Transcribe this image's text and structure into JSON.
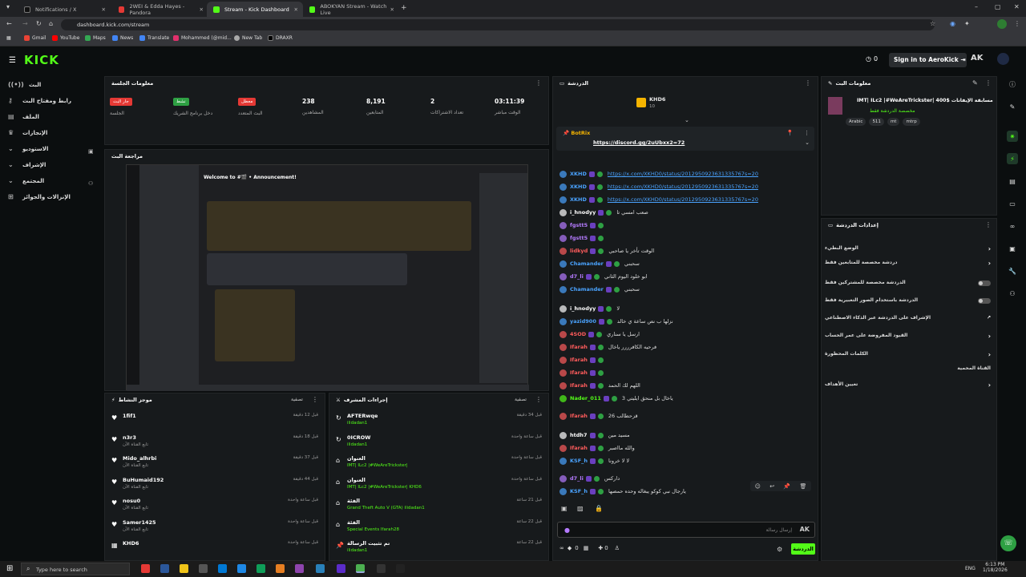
{
  "browser": {
    "tabs": [
      {
        "label": "Notifications / X",
        "color": "#111111"
      },
      {
        "label": "2WEI & Edda Hayes - Pandora",
        "color": "#e53935"
      },
      {
        "label": "Stream - Kick Dashboard",
        "color": "#53fc18"
      },
      {
        "label": "ABOKYAN Stream - Watch Live",
        "color": "#53fc18"
      }
    ],
    "url": "dashboard.kick.com/stream",
    "bookmarks": [
      "Gmail",
      "YouTube",
      "Maps",
      "News",
      "Translate",
      "Mohammed (@mid...",
      "New Tab",
      "DRAXR"
    ]
  },
  "header": {
    "logo": "KICK",
    "notif_count": "0",
    "signin_label": "Sign in to AeroKick"
  },
  "sidebar": {
    "items": [
      "البث",
      "رابط ومفتاح البث",
      "الملف",
      "الإنجازات",
      "الاستوديو",
      "الإشراف",
      "المجتمع",
      "الإنزالات والجوائز"
    ]
  },
  "session": {
    "title": "معلومات الجلسة",
    "badges": [
      {
        "label": "جار البث",
        "color": "#e53935",
        "sub": "الجلسة"
      },
      {
        "label": "نشط",
        "color": "#2ea043",
        "sub": "دخل برنامج الشريك"
      },
      {
        "label": "معطل",
        "color": "#e53935",
        "sub": "البث المتعدد"
      }
    ],
    "stats": [
      {
        "value": "238",
        "label": "المشاهدين"
      },
      {
        "value": "8,191",
        "label": "المتابعين"
      },
      {
        "value": "2",
        "label": "تعداد الاشتراكات"
      },
      {
        "value": "03:11:39",
        "label": "الوقت مباشر"
      }
    ]
  },
  "preview": {
    "title": "مراجعة البث",
    "welcome": "Welcome to #🎬 • Announcement!",
    "channel": "• Announcement!"
  },
  "activity": {
    "title": "موجز النشاط",
    "filter": "تصفية",
    "rows": [
      {
        "name": "1fif1",
        "sub": "",
        "time": "قبل 12 دقيقة"
      },
      {
        "name": "n3r3",
        "sub": "تابع القناة الآن",
        "time": "قبل 18 دقيقة"
      },
      {
        "name": "Mido_alhrbi",
        "sub": "تابع القناة الآن",
        "time": "قبل 37 دقيقة"
      },
      {
        "name": "BuHumaid192",
        "sub": "تابع القناة الآن",
        "time": "قبل 44 دقيقة"
      },
      {
        "name": "nosu0",
        "sub": "تابع القناة الآن",
        "time": "قبل ساعة واحدة"
      },
      {
        "name": "Samer1425",
        "sub": "تابع القناة الآن",
        "time": "قبل ساعة واحدة"
      },
      {
        "name": "KHD6",
        "sub": "",
        "time": "قبل ساعة واحدة"
      }
    ]
  },
  "modactions": {
    "title": "إجراءات المشرف",
    "filter": "تصفية",
    "rows": [
      {
        "name": "AFTERwqe",
        "sub": "ilidadan1",
        "time": "قبل 34 دقيقة"
      },
      {
        "name": "0ICROW",
        "sub": "ilidadan1",
        "time": "قبل ساعة واحدة"
      },
      {
        "name": "العنوان",
        "sub": "IMT| ILc2 |#WeAreTrickster|",
        "time": "قبل ساعة واحدة"
      },
      {
        "name": "العنوان",
        "sub": "IMT| ILc2 |#WeAreTrickster| KHD6",
        "time": "قبل ساعة واحدة"
      },
      {
        "name": "الفئة",
        "sub": "Grand Theft Auto V (GTA) ilidadan1",
        "time": "قبل 21 ساعة"
      },
      {
        "name": "الفئة",
        "sub": "Special Events Ifarah28",
        "time": "قبل 22 ساعة"
      },
      {
        "name": "تم تثبيت الرسالة",
        "sub": "ilidadan1",
        "time": "قبل 22 ساعة"
      }
    ]
  },
  "chat": {
    "title": "الدردشة",
    "top_user": "KHD6",
    "top_count": "10",
    "pinned_user": "BotRix",
    "pinned_link": "https://discord.gg/2uUbxx2=72",
    "messages": [
      {
        "user": "XKHD",
        "color": "#4aa3ff",
        "text": "https://x.com/XKHD0/status/2012950923631335767s=20",
        "link": true
      },
      {
        "user": "XKHD",
        "color": "#4aa3ff",
        "text": "https://x.com/XKHD0/status/2012950923631335767s=20",
        "link": true
      },
      {
        "user": "XKHD",
        "color": "#4aa3ff",
        "text": "https://x.com/XKHD0/status/2012950923631335767s=20",
        "link": true
      },
      {
        "user": "i_hnodyy",
        "color": "#ffffff",
        "text": "صعب امسي تا"
      },
      {
        "user": "fgstt5",
        "color": "#b57bff",
        "text": ""
      },
      {
        "user": "fgstt5",
        "color": "#b57bff",
        "text": ""
      },
      {
        "user": "lidkyd",
        "color": "#ff5c5c",
        "text": "الوقت تأخر يا صاحبي"
      },
      {
        "user": "Chamander",
        "color": "#4aa3ff",
        "text": "سحبني"
      },
      {
        "user": "d7_li",
        "color": "#b57bff",
        "text": "ابو خلود اليوم الثاني"
      },
      {
        "user": "Chamander",
        "color": "#4aa3ff",
        "text": "سحبني"
      },
      {
        "user": "i_hnodyy",
        "color": "#ffffff",
        "text": "لا"
      },
      {
        "user": "yazid900",
        "color": "#4aa3ff",
        "text": "نزلها ب نص ساعة ي خالد"
      },
      {
        "user": "4SOD",
        "color": "#ff5c5c",
        "text": "ارسل يا سناري"
      },
      {
        "user": "Ifarah",
        "color": "#ff5c5c",
        "text": "فرحيه الكافرررر ياخال"
      },
      {
        "user": "Ifarah",
        "color": "#ff5c5c",
        "text": ""
      },
      {
        "user": "Ifarah",
        "color": "#ff5c5c",
        "text": ""
      },
      {
        "user": "Ifarah",
        "color": "#ff5c5c",
        "text": "اللهم لك الحمد"
      },
      {
        "user": "Nader_011",
        "color": "#53fc18",
        "text": "ياخال بل منحق ايليتي 3"
      },
      {
        "user": "Ifarah",
        "color": "#ff5c5c",
        "text": "قزحطالب 26"
      },
      {
        "user": "htdh7",
        "color": "#ffffff",
        "text": "مسيد مين"
      },
      {
        "user": "Ifarah",
        "color": "#ff5c5c",
        "text": "والله مااصبر"
      },
      {
        "user": "KSF_h",
        "color": "#4aa3ff",
        "text": "لا لا خرونا"
      },
      {
        "user": "d7_li",
        "color": "#b57bff",
        "text": "داركس"
      },
      {
        "user": "KSF_h",
        "color": "#4aa3ff",
        "text": "يارجال نبي كوكو يبغاله وحده حمصها"
      }
    ],
    "input_placeholder": "إرسال رسالة",
    "send_label": "الدردشة",
    "bottom_count1": "0",
    "bottom_count2": "0"
  },
  "streaminfo": {
    "title": "معلومات البث",
    "stream_title": "IMT| ILc2 |#WeAreTrickster| مسابقة الإيفانات $400",
    "category": "مخصصة الدردشة فقط",
    "tags": [
      "Arabic",
      "511",
      "mt",
      "mtrp"
    ]
  },
  "chatsettings": {
    "title": "إعدادات الدردشة",
    "items": [
      {
        "label": "الوضع البطيء",
        "kind": "arrow"
      },
      {
        "label": "دردشة مخصصة للمتابعين فقط",
        "kind": "arrow"
      },
      {
        "label": "الدردشة مخصصة للمشتركين فقط",
        "kind": "toggle"
      },
      {
        "label": "الدردشة باستخدام الصور التعبيرية فقط",
        "kind": "toggle"
      },
      {
        "label": "الإشراف على الدردشة عبر الذكاء الاصطناعي",
        "kind": "ext"
      },
      {
        "label": "القيود المفروضة على عمر الحساب",
        "kind": "arrow"
      },
      {
        "label": "الكلمات المحظورة",
        "kind": "arrow"
      },
      {
        "label": "القناة المحمية",
        "kind": "none"
      },
      {
        "label": "تعيين الأهداف",
        "kind": "arrow"
      }
    ]
  },
  "taskbar": {
    "search_placeholder": "Type here to search",
    "lang": "ENG",
    "time": "6:13 PM",
    "date": "1/18/2026"
  }
}
